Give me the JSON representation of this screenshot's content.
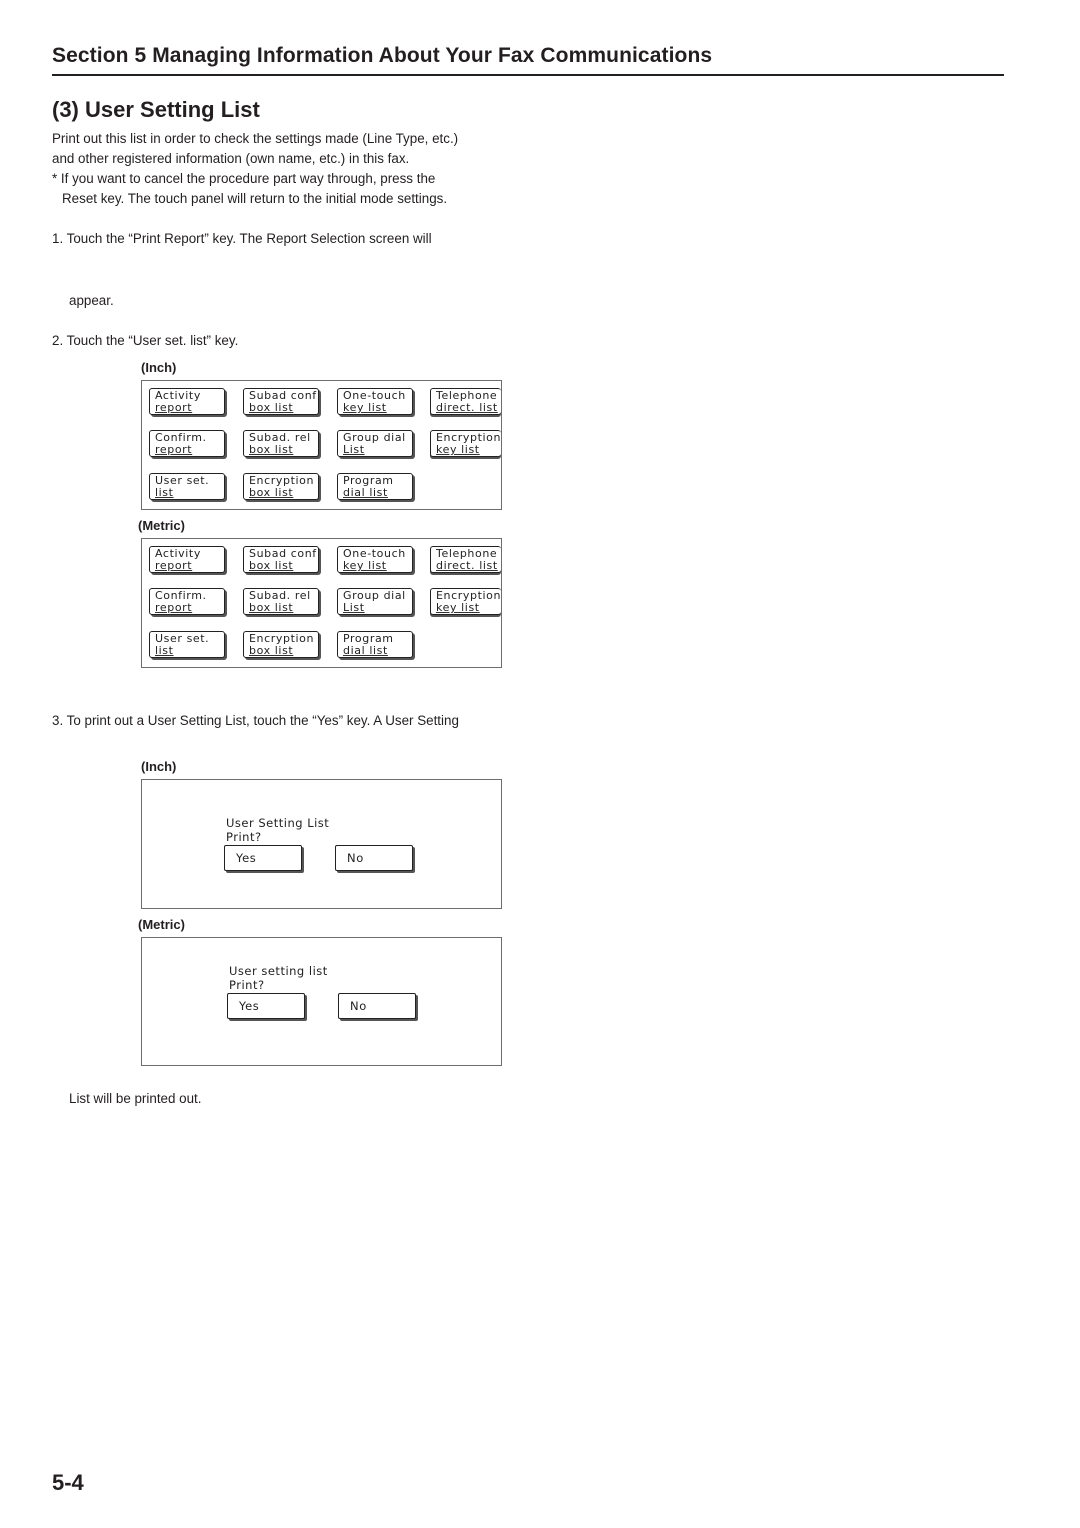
{
  "section_header": "Section 5  Managing Information About Your Fax Communications",
  "heading": "(3) User Setting List",
  "intro": {
    "line1": "Print out this list in order to check the settings made (Line Type, etc.)",
    "line2": "and other registered information (own name, etc.) in this fax.",
    "note_line1": "* If you want to cancel the procedure part way through, press the",
    "note_line2": "Reset key. The touch panel will return to the initial mode settings."
  },
  "steps": {
    "step1_a": "1. Touch the “Print Report” key. The Report Selection screen will",
    "step1_b": "appear.",
    "step2": "2. Touch the “User set. list” key.",
    "step3_a": "3. To print out a User Setting List, touch the “Yes” key. A User Setting",
    "step3_b": "List will be printed out."
  },
  "report_selection": {
    "inch": {
      "label": "(Inch)",
      "buttons": [
        {
          "l1": "Activity",
          "l2": "report"
        },
        {
          "l1": "Subad conf",
          "l2": "box list"
        },
        {
          "l1": "One-touch",
          "l2": "key list"
        },
        {
          "l1": "Telephone",
          "l2": "direct. list"
        },
        {
          "l1": "Confirm.",
          "l2": "report"
        },
        {
          "l1": "Subad. rel",
          "l2": "box list"
        },
        {
          "l1": "Group dial",
          "l2": "List"
        },
        {
          "l1": "Encryption",
          "l2": "key list"
        },
        {
          "l1": "User set.",
          "l2": "list"
        },
        {
          "l1": "Encryption",
          "l2": "box list"
        },
        {
          "l1": "Program",
          "l2": "dial list"
        }
      ]
    },
    "metric": {
      "label": "(Metric)",
      "buttons": [
        {
          "l1": "Activity",
          "l2": "report"
        },
        {
          "l1": "Subad conf",
          "l2": "box list"
        },
        {
          "l1": "One-touch",
          "l2": "key list"
        },
        {
          "l1": "Telephone",
          "l2": "direct. list"
        },
        {
          "l1": "Confirm.",
          "l2": "report"
        },
        {
          "l1": "Subad. rel",
          "l2": "box list"
        },
        {
          "l1": "Group dial",
          "l2": "List"
        },
        {
          "l1": "Encryption",
          "l2": "key list"
        },
        {
          "l1": "User set.",
          "l2": "list"
        },
        {
          "l1": "Encryption",
          "l2": "box list"
        },
        {
          "l1": "Program",
          "l2": "dial list"
        }
      ]
    }
  },
  "confirm_dialog": {
    "inch": {
      "label": "(Inch)",
      "title": "User Setting List",
      "prompt": "Print?",
      "yes": "Yes",
      "no": "No"
    },
    "metric": {
      "label": "(Metric)",
      "title": "User setting list",
      "prompt": "Print?",
      "yes": "Yes",
      "no": "No"
    }
  },
  "page_number": "5-4"
}
